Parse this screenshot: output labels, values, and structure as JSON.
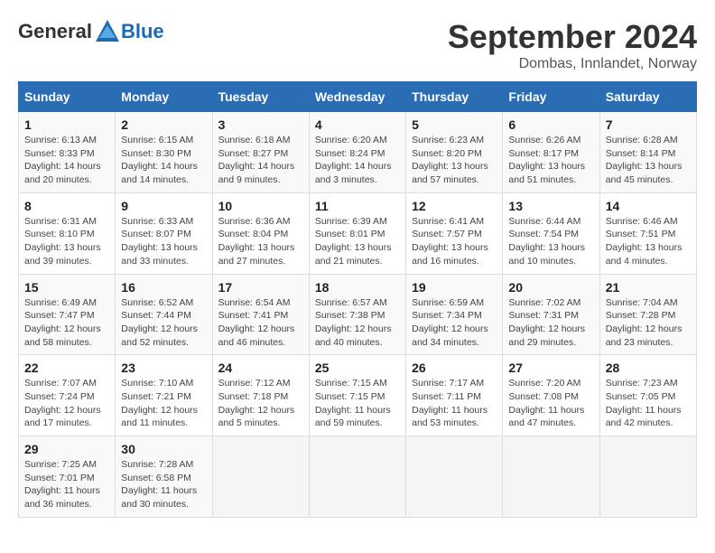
{
  "header": {
    "logo_general": "General",
    "logo_blue": "Blue",
    "title": "September 2024",
    "subtitle": "Dombas, Innlandet, Norway"
  },
  "days_of_week": [
    "Sunday",
    "Monday",
    "Tuesday",
    "Wednesday",
    "Thursday",
    "Friday",
    "Saturday"
  ],
  "weeks": [
    [
      {
        "day": "1",
        "info": "Sunrise: 6:13 AM\nSunset: 8:33 PM\nDaylight: 14 hours\nand 20 minutes."
      },
      {
        "day": "2",
        "info": "Sunrise: 6:15 AM\nSunset: 8:30 PM\nDaylight: 14 hours\nand 14 minutes."
      },
      {
        "day": "3",
        "info": "Sunrise: 6:18 AM\nSunset: 8:27 PM\nDaylight: 14 hours\nand 9 minutes."
      },
      {
        "day": "4",
        "info": "Sunrise: 6:20 AM\nSunset: 8:24 PM\nDaylight: 14 hours\nand 3 minutes."
      },
      {
        "day": "5",
        "info": "Sunrise: 6:23 AM\nSunset: 8:20 PM\nDaylight: 13 hours\nand 57 minutes."
      },
      {
        "day": "6",
        "info": "Sunrise: 6:26 AM\nSunset: 8:17 PM\nDaylight: 13 hours\nand 51 minutes."
      },
      {
        "day": "7",
        "info": "Sunrise: 6:28 AM\nSunset: 8:14 PM\nDaylight: 13 hours\nand 45 minutes."
      }
    ],
    [
      {
        "day": "8",
        "info": "Sunrise: 6:31 AM\nSunset: 8:10 PM\nDaylight: 13 hours\nand 39 minutes."
      },
      {
        "day": "9",
        "info": "Sunrise: 6:33 AM\nSunset: 8:07 PM\nDaylight: 13 hours\nand 33 minutes."
      },
      {
        "day": "10",
        "info": "Sunrise: 6:36 AM\nSunset: 8:04 PM\nDaylight: 13 hours\nand 27 minutes."
      },
      {
        "day": "11",
        "info": "Sunrise: 6:39 AM\nSunset: 8:01 PM\nDaylight: 13 hours\nand 21 minutes."
      },
      {
        "day": "12",
        "info": "Sunrise: 6:41 AM\nSunset: 7:57 PM\nDaylight: 13 hours\nand 16 minutes."
      },
      {
        "day": "13",
        "info": "Sunrise: 6:44 AM\nSunset: 7:54 PM\nDaylight: 13 hours\nand 10 minutes."
      },
      {
        "day": "14",
        "info": "Sunrise: 6:46 AM\nSunset: 7:51 PM\nDaylight: 13 hours\nand 4 minutes."
      }
    ],
    [
      {
        "day": "15",
        "info": "Sunrise: 6:49 AM\nSunset: 7:47 PM\nDaylight: 12 hours\nand 58 minutes."
      },
      {
        "day": "16",
        "info": "Sunrise: 6:52 AM\nSunset: 7:44 PM\nDaylight: 12 hours\nand 52 minutes."
      },
      {
        "day": "17",
        "info": "Sunrise: 6:54 AM\nSunset: 7:41 PM\nDaylight: 12 hours\nand 46 minutes."
      },
      {
        "day": "18",
        "info": "Sunrise: 6:57 AM\nSunset: 7:38 PM\nDaylight: 12 hours\nand 40 minutes."
      },
      {
        "day": "19",
        "info": "Sunrise: 6:59 AM\nSunset: 7:34 PM\nDaylight: 12 hours\nand 34 minutes."
      },
      {
        "day": "20",
        "info": "Sunrise: 7:02 AM\nSunset: 7:31 PM\nDaylight: 12 hours\nand 29 minutes."
      },
      {
        "day": "21",
        "info": "Sunrise: 7:04 AM\nSunset: 7:28 PM\nDaylight: 12 hours\nand 23 minutes."
      }
    ],
    [
      {
        "day": "22",
        "info": "Sunrise: 7:07 AM\nSunset: 7:24 PM\nDaylight: 12 hours\nand 17 minutes."
      },
      {
        "day": "23",
        "info": "Sunrise: 7:10 AM\nSunset: 7:21 PM\nDaylight: 12 hours\nand 11 minutes."
      },
      {
        "day": "24",
        "info": "Sunrise: 7:12 AM\nSunset: 7:18 PM\nDaylight: 12 hours\nand 5 minutes."
      },
      {
        "day": "25",
        "info": "Sunrise: 7:15 AM\nSunset: 7:15 PM\nDaylight: 11 hours\nand 59 minutes."
      },
      {
        "day": "26",
        "info": "Sunrise: 7:17 AM\nSunset: 7:11 PM\nDaylight: 11 hours\nand 53 minutes."
      },
      {
        "day": "27",
        "info": "Sunrise: 7:20 AM\nSunset: 7:08 PM\nDaylight: 11 hours\nand 47 minutes."
      },
      {
        "day": "28",
        "info": "Sunrise: 7:23 AM\nSunset: 7:05 PM\nDaylight: 11 hours\nand 42 minutes."
      }
    ],
    [
      {
        "day": "29",
        "info": "Sunrise: 7:25 AM\nSunset: 7:01 PM\nDaylight: 11 hours\nand 36 minutes."
      },
      {
        "day": "30",
        "info": "Sunrise: 7:28 AM\nSunset: 6:58 PM\nDaylight: 11 hours\nand 30 minutes."
      },
      {
        "day": "",
        "info": ""
      },
      {
        "day": "",
        "info": ""
      },
      {
        "day": "",
        "info": ""
      },
      {
        "day": "",
        "info": ""
      },
      {
        "day": "",
        "info": ""
      }
    ]
  ]
}
